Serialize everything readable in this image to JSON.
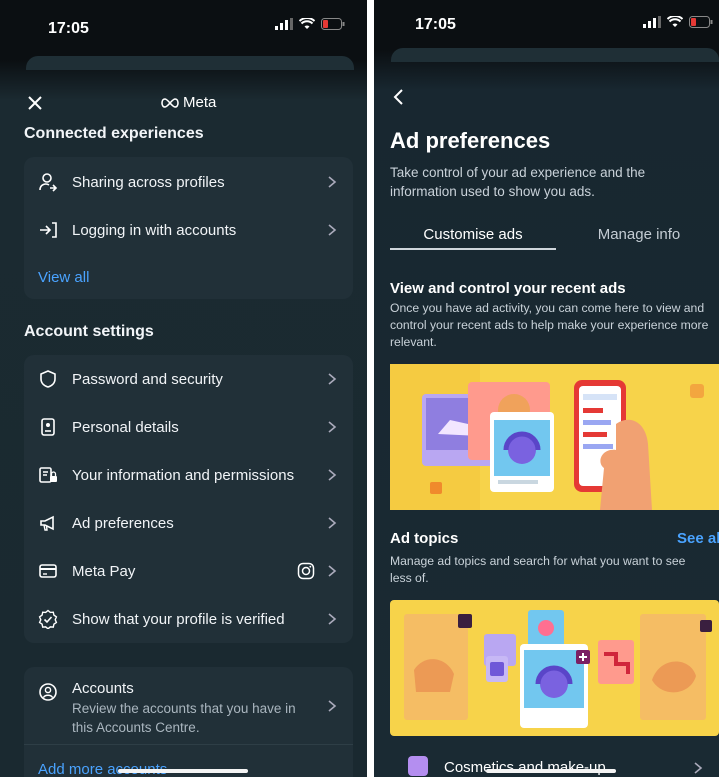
{
  "left": {
    "status_time": "17:05",
    "brand": "Meta",
    "connected": {
      "title": "Connected experiences",
      "items": [
        {
          "label": "Sharing across profiles",
          "icon": "profiles-share-icon"
        },
        {
          "label": "Logging in with accounts",
          "icon": "login-arrow-icon"
        }
      ],
      "view_all": "View all"
    },
    "account_settings": {
      "title": "Account settings",
      "items": [
        {
          "label": "Password and security",
          "icon": "shield-icon"
        },
        {
          "label": "Personal details",
          "icon": "id-card-icon"
        },
        {
          "label": "Your information and permissions",
          "icon": "info-permissions-icon"
        },
        {
          "label": "Ad preferences",
          "icon": "megaphone-icon"
        },
        {
          "label": "Meta Pay",
          "icon": "card-icon"
        },
        {
          "label": "Show that your profile is verified",
          "icon": "verified-badge-icon"
        }
      ]
    },
    "accounts": {
      "title": "Accounts",
      "description": "Review the accounts that you have in this Accounts Centre.",
      "add_more": "Add more accounts"
    }
  },
  "right": {
    "status_time": "17:05",
    "title": "Ad preferences",
    "subtitle": "Take control of your ad experience and the information used to show you ads.",
    "tabs": [
      {
        "label": "Customise ads",
        "active": true
      },
      {
        "label": "Manage info",
        "active": false
      }
    ],
    "recent_ads": {
      "title": "View and control your recent ads",
      "description": "Once you have ad activity, you can come here to view and control your recent ads to help make your experience more relevant."
    },
    "ad_topics": {
      "title": "Ad topics",
      "see_all": "See all",
      "description": "Manage ad topics and search for what you want to see less of."
    },
    "topic_item": "Cosmetics and make-up"
  },
  "colors": {
    "accent": "#4aa3ff",
    "background": "#1a2930",
    "card": "#213038",
    "illustration_yellow": "#f7d34a"
  }
}
